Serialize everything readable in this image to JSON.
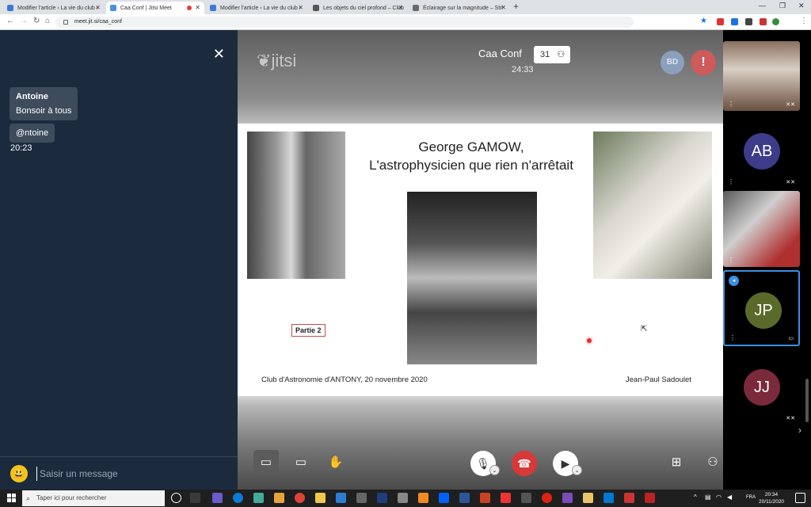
{
  "browser": {
    "tabs": [
      {
        "title": "Modifier l'article ‹ La vie du club ›"
      },
      {
        "title": "Caa Conf | Jitsi Meet"
      },
      {
        "title": "Modifier l'article ‹ La vie du club ›"
      },
      {
        "title": "Les objets du ciel profond – Club"
      },
      {
        "title": "Éclairage sur la magnitude – Stri"
      }
    ],
    "new_tab": "+",
    "url": "meet.jit.si/caa_conf"
  },
  "chat": {
    "messages": [
      {
        "sender": "Antoine",
        "text": "Bonsoir à tous"
      },
      {
        "sender": "",
        "text": "@ntoine"
      }
    ],
    "time": "20:23",
    "input_placeholder": "Saisir un message",
    "emoji": "😃"
  },
  "header": {
    "logo": "jitsi",
    "conference_name": "Caa Conf",
    "participant_count": "31",
    "timer": "24:33",
    "avatar_initials": "BD",
    "warning": "!"
  },
  "slide": {
    "title_line1": "George GAMOW,",
    "title_line2": "L'astrophysicien que rien n'arrêtait",
    "part_label": "Partie 2",
    "footer_left": "Club d'Astronomie d'ANTONY, 20 novembre 2020",
    "footer_right": "Jean-Paul Sadoulet"
  },
  "filmstrip": [
    {
      "initials": "",
      "color": "#5a4a3a",
      "video": true
    },
    {
      "initials": "AB",
      "color": "#3c3c8a"
    },
    {
      "initials": "",
      "color": "#6a6a6a",
      "video": true
    },
    {
      "initials": "JP",
      "color": "#5a6a2a",
      "active": true
    },
    {
      "initials": "JJ",
      "color": "#7a2a3a"
    }
  ],
  "taskbar": {
    "search_placeholder": "Taper ici pour rechercher",
    "language": "FRA",
    "time": "20:34",
    "date": "20/11/2020"
  }
}
